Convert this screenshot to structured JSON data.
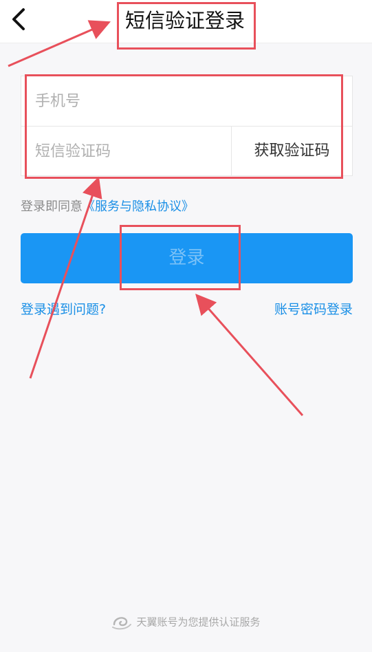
{
  "header": {
    "back_icon": "chevron-left-icon",
    "title": "短信验证登录"
  },
  "form": {
    "phone_placeholder": "手机号",
    "code_placeholder": "短信验证码",
    "get_code_label": "获取验证码"
  },
  "agreement": {
    "prefix": "登录即同意",
    "link": "《服务与隐私协议》"
  },
  "login_button": {
    "label": "登录"
  },
  "links": {
    "help": "登录遇到问题?",
    "password_login": "账号密码登录"
  },
  "footer": {
    "logo_icon": "tianyi-logo-icon",
    "text": "天翼账号为您提供认证服务"
  },
  "colors": {
    "primary": "#1a96f4",
    "link": "#1a8fe6",
    "annotation": "#e8505b",
    "background": "#f7f7f9"
  }
}
